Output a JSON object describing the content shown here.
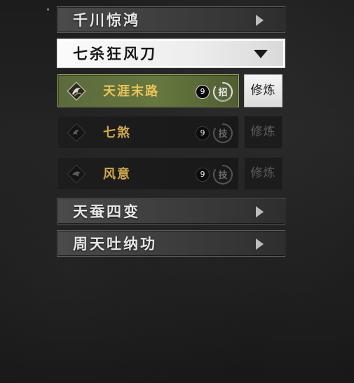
{
  "categories": {
    "cat1": "千川惊鸿",
    "cat2": "七杀狂风刀",
    "cat3": "天蚕四变",
    "cat4": "周天吐纳功"
  },
  "skills": [
    {
      "name": "天涯末路",
      "level": "9",
      "type": "招",
      "train": "修炼",
      "selected": true
    },
    {
      "name": "七煞",
      "level": "9",
      "type": "技",
      "train": "修炼",
      "selected": false
    },
    {
      "name": "风意",
      "level": "9",
      "type": "技",
      "train": "修炼",
      "selected": false
    }
  ],
  "colors": {
    "selected_row": "#66773f",
    "skill_name": "#e9c45a",
    "train_active": "#e6e6e6"
  },
  "icons": {
    "expand_closed": "arrow-right-icon",
    "expand_open": "arrow-down-icon",
    "skill_emblem": "swirl-emblem-icon",
    "type_badge": "brush-circle-icon"
  }
}
